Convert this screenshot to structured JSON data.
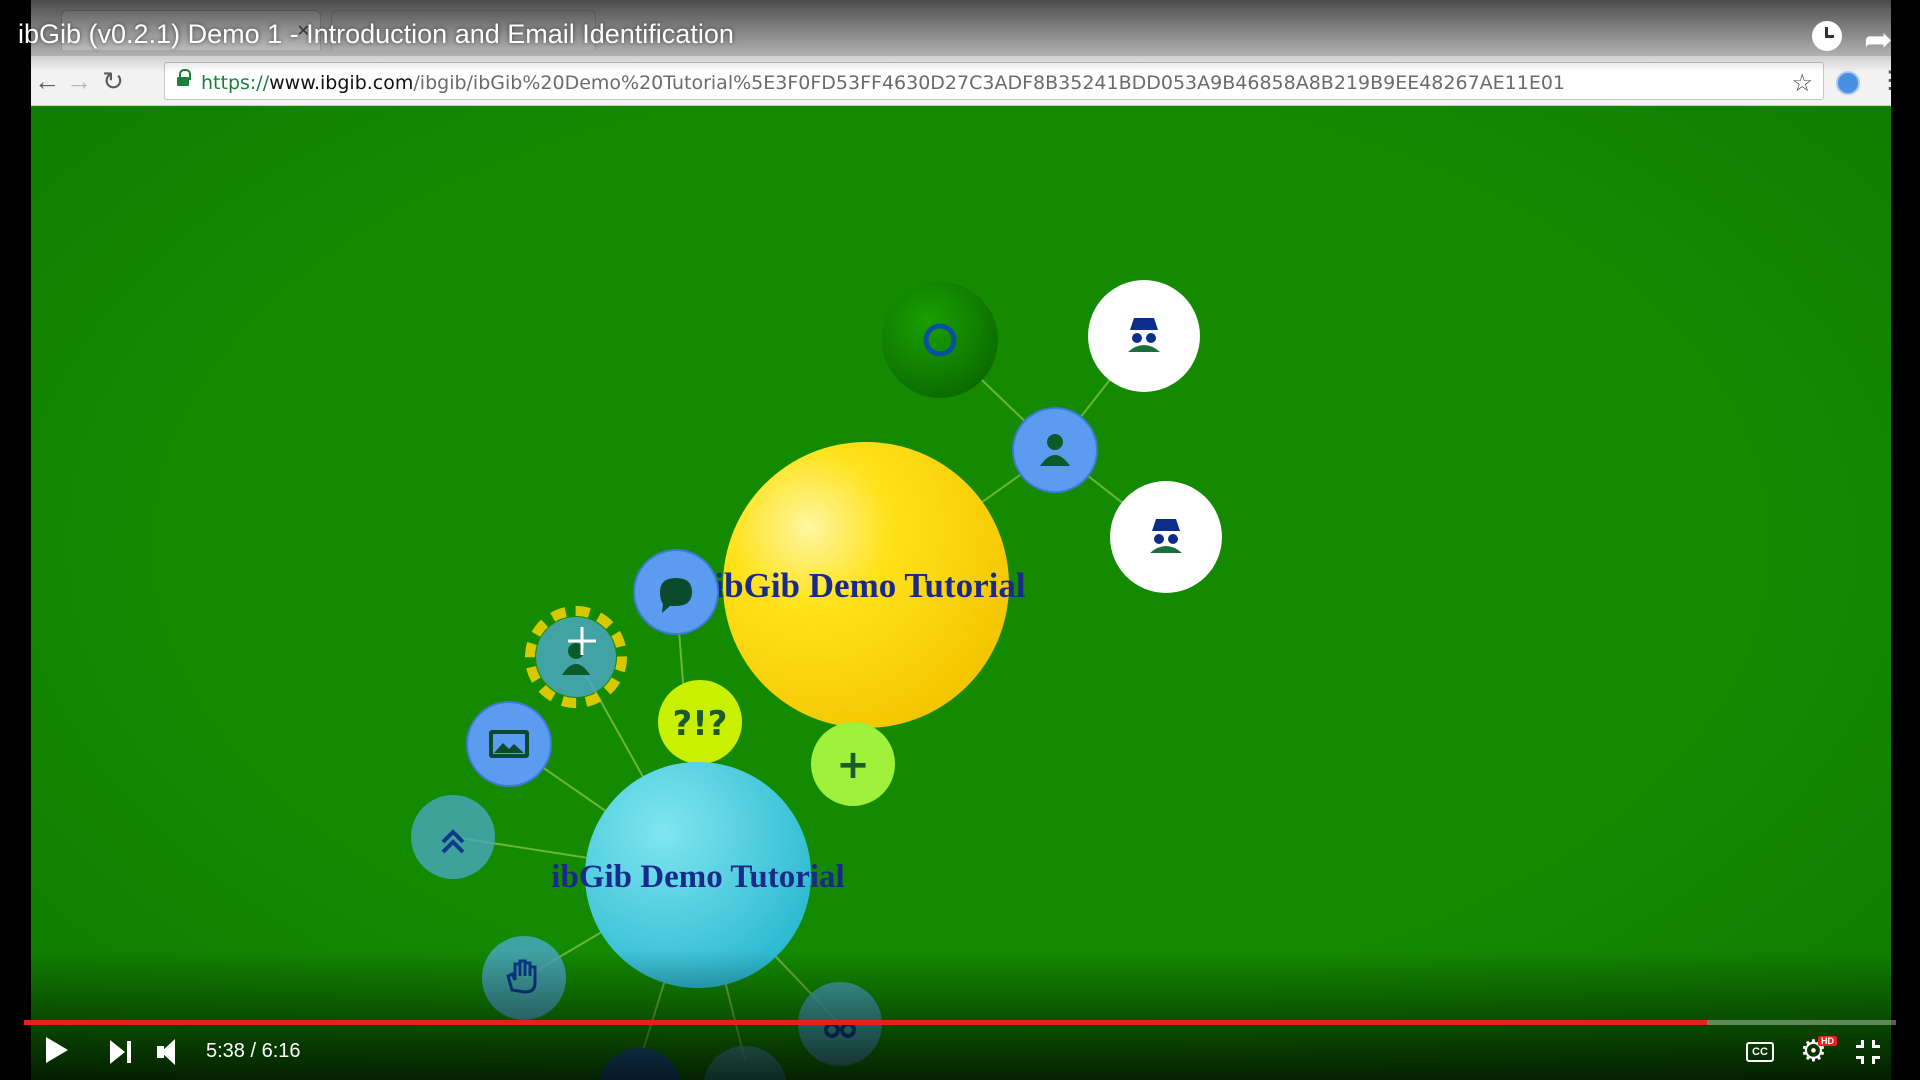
{
  "video": {
    "title": "ibGib (v0.2.1) Demo 1 - Introduction and Email Identification",
    "current_time": "5:38",
    "duration": "6:16",
    "time_display": "5:38 / 6:16",
    "progress_fraction": 0.8989,
    "cc_label": "CC",
    "hd_badge": "HD"
  },
  "browser": {
    "url_scheme": "https://",
    "url_host": "www.ibgib.com",
    "url_path": "/ibgib/ibGib%20Demo%20Tutorial%5E3F0FD53FF4630D27C3ADF8B35241BDD053A9B46858A8B219B9EE48267AE11E01"
  },
  "graph": {
    "main_node_label": "ibGib Demo Tutorial",
    "secondary_node_label": "ibGib Demo Tutorial",
    "query_node_label": "?!?",
    "add_node_label": "+"
  },
  "colors": {
    "canvas_bg": "#138a00",
    "main_node": "#ffd400",
    "secondary_node": "#35c8dc",
    "action_node": "#5b9bf0",
    "query_node": "#c9f000",
    "add_node": "#9ef03a",
    "progress": "#e62117",
    "node_text": "#1a2a8a"
  },
  "icons": {
    "back": "arrow-left-icon",
    "forward": "arrow-right-icon",
    "reload": "reload-icon",
    "lock": "lock-icon",
    "bookmark": "star-icon",
    "watch_later": "clock-icon",
    "share": "share-arrow-icon",
    "play": "play-icon",
    "next": "next-icon",
    "volume": "volume-icon",
    "captions": "cc-icon",
    "settings": "gear-icon",
    "fullscreen_exit": "fullscreen-exit-icon"
  }
}
